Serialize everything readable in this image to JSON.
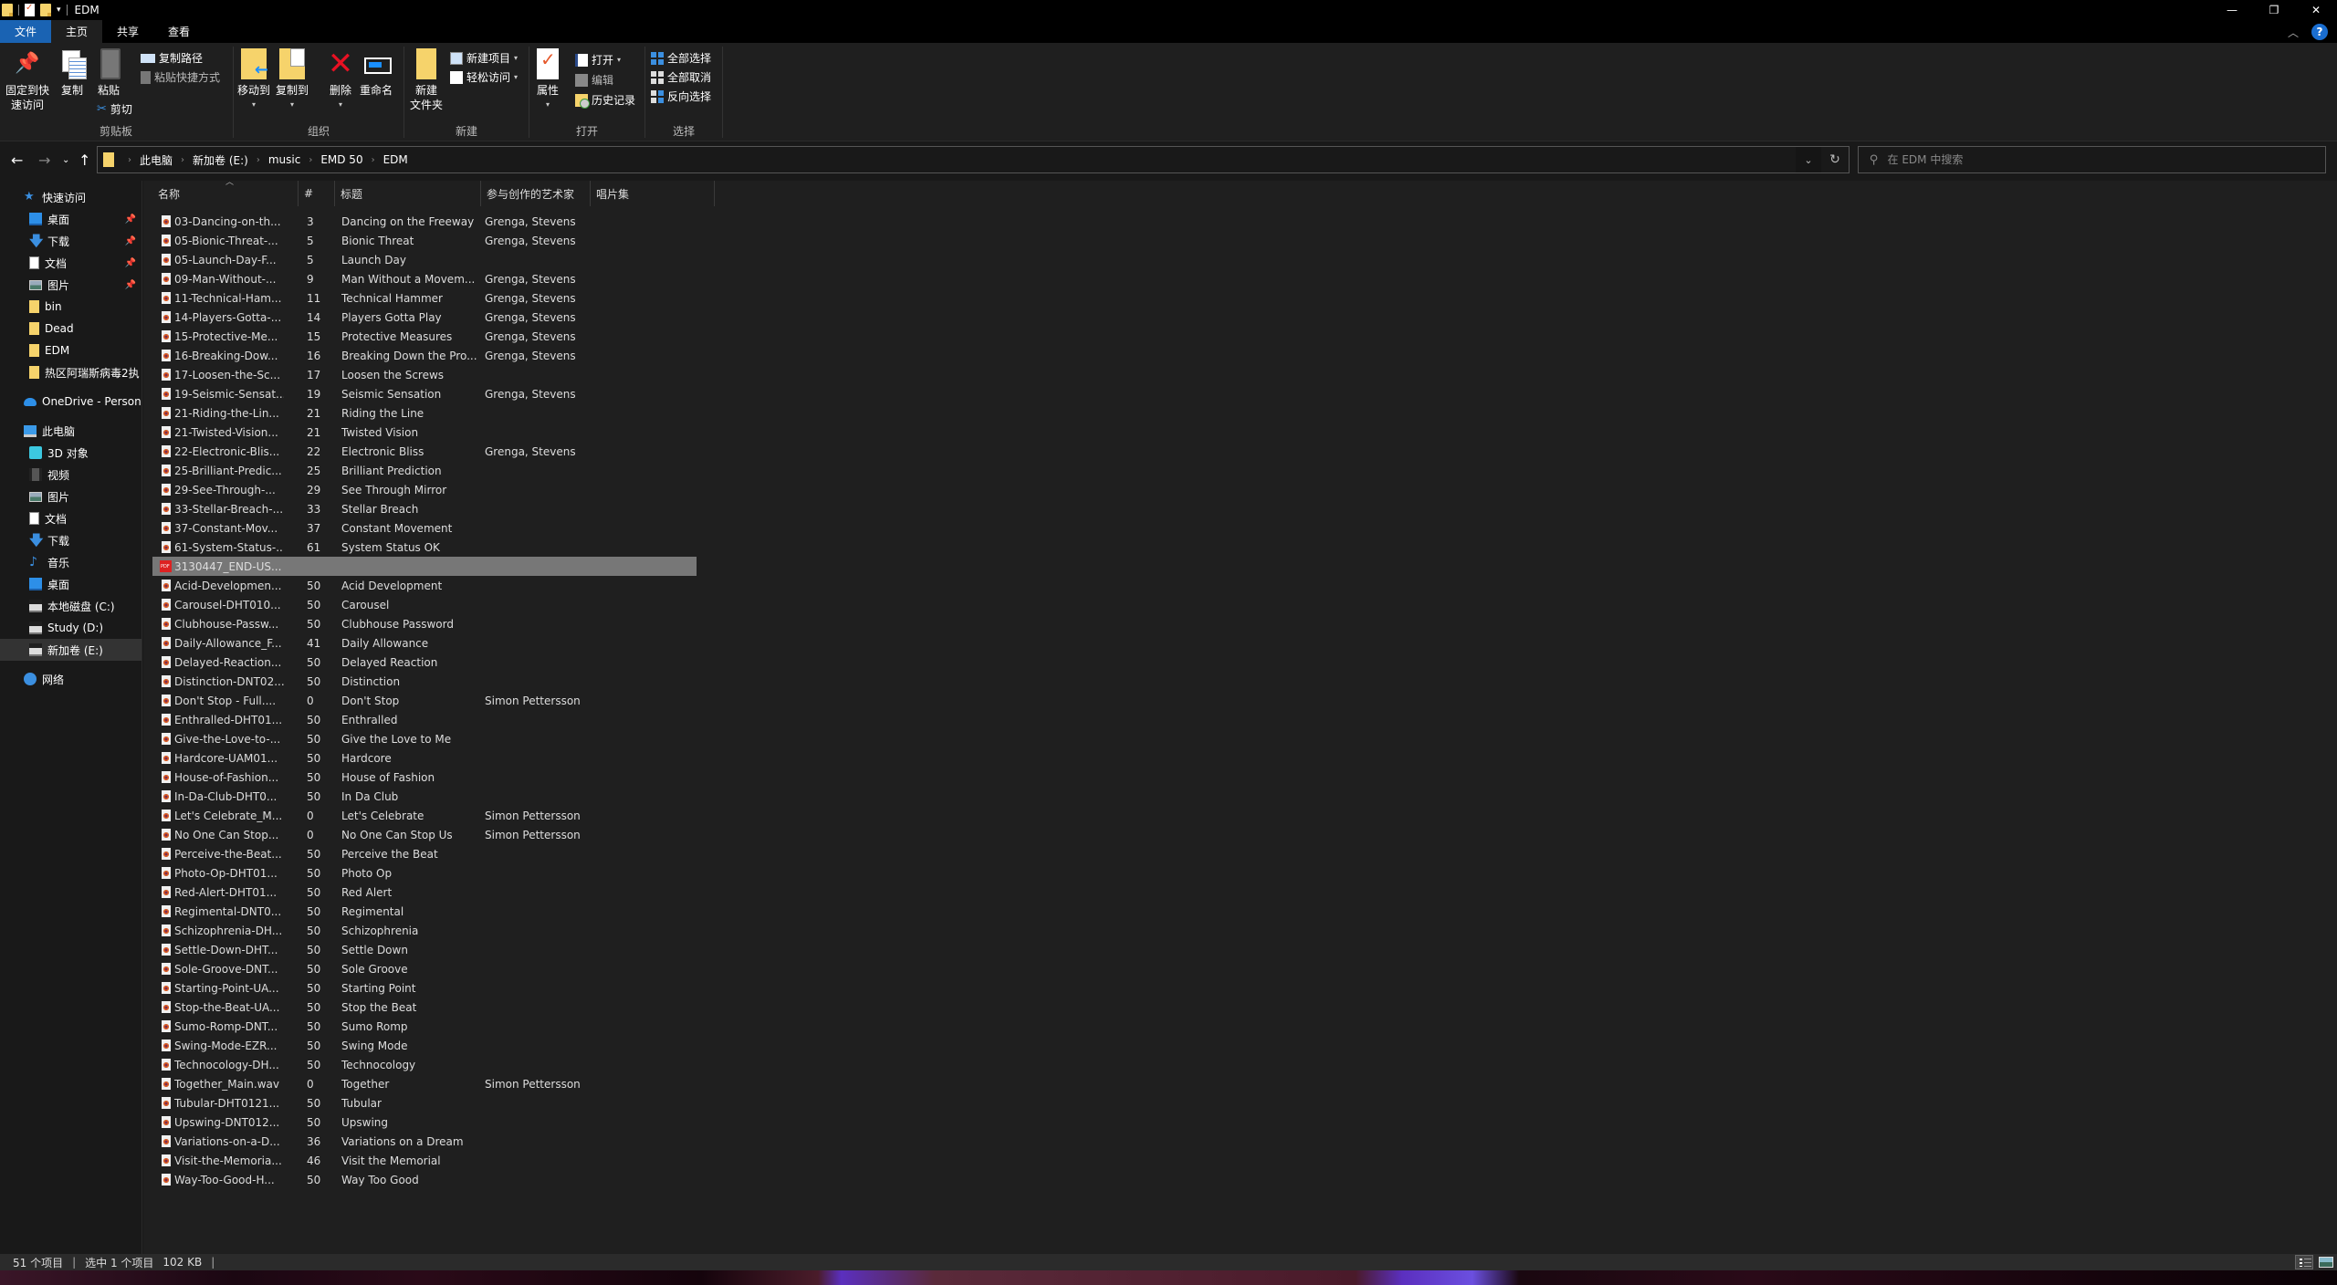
{
  "window": {
    "title": "EDM",
    "controls": {
      "minimize": "—",
      "maximize": "❐",
      "close": "✕"
    }
  },
  "ribbon": {
    "tabs": [
      {
        "label": "文件"
      },
      {
        "label": "主页"
      },
      {
        "label": "共享"
      },
      {
        "label": "查看"
      }
    ],
    "groups": {
      "clipboard": {
        "label": "剪贴板",
        "pin": "固定到快\n速访问",
        "pin_line1": "固定到快",
        "pin_line2": "速访问",
        "copy": "复制",
        "paste": "粘贴",
        "copy_path": "复制路径",
        "paste_shortcut": "粘贴快捷方式",
        "cut": "剪切"
      },
      "organize": {
        "label": "组织",
        "move_to": "移动到",
        "copy_to": "复制到",
        "delete": "删除",
        "rename": "重命名"
      },
      "new": {
        "label": "新建",
        "new_folder_line1": "新建",
        "new_folder_line2": "文件夹",
        "new_item": "新建项目",
        "easy_access": "轻松访问"
      },
      "open": {
        "label": "打开",
        "properties": "属性",
        "open": "打开",
        "edit": "编辑",
        "history": "历史记录"
      },
      "select": {
        "label": "选择",
        "select_all": "全部选择",
        "select_none": "全部取消",
        "invert_selection": "反向选择"
      }
    }
  },
  "address": {
    "breadcrumb": [
      "此电脑",
      "新加卷 (E:)",
      "music",
      "EMD 50",
      "EDM"
    ],
    "search_placeholder": "在 EDM 中搜索"
  },
  "sidebar": {
    "quick_access": {
      "label": "快速访问",
      "items": [
        {
          "label": "桌面",
          "icon": "desktop-icon",
          "pinned": true
        },
        {
          "label": "下载",
          "icon": "download-icon",
          "pinned": true
        },
        {
          "label": "文档",
          "icon": "document-icon",
          "pinned": true
        },
        {
          "label": "图片",
          "icon": "pictures-icon",
          "pinned": true
        },
        {
          "label": "bin",
          "icon": "folder-icon",
          "pinned": false
        },
        {
          "label": "Dead",
          "icon": "folder-icon",
          "pinned": false
        },
        {
          "label": "EDM",
          "icon": "folder-icon",
          "pinned": false
        },
        {
          "label": "热区阿瑞斯病毒2执",
          "icon": "folder-icon",
          "pinned": false
        }
      ]
    },
    "onedrive": {
      "label": "OneDrive - Persona"
    },
    "this_pc": {
      "label": "此电脑",
      "items": [
        {
          "label": "3D 对象",
          "icon": "3d-objects-icon"
        },
        {
          "label": "视频",
          "icon": "video-icon"
        },
        {
          "label": "图片",
          "icon": "pictures-icon"
        },
        {
          "label": "文档",
          "icon": "document-icon"
        },
        {
          "label": "下载",
          "icon": "download-icon"
        },
        {
          "label": "音乐",
          "icon": "music-icon"
        },
        {
          "label": "桌面",
          "icon": "desktop-icon"
        },
        {
          "label": "本地磁盘 (C:)",
          "icon": "drive-icon"
        },
        {
          "label": "Study (D:)",
          "icon": "drive-icon"
        },
        {
          "label": "新加卷 (E:)",
          "icon": "drive-icon",
          "selected": true
        }
      ]
    },
    "network": {
      "label": "网络"
    }
  },
  "filelist": {
    "columns": [
      "名称",
      "#",
      "标题",
      "参与创作的艺术家",
      "唱片集"
    ],
    "rows": [
      {
        "name": "03-Dancing-on-th...",
        "num": "3",
        "title": "Dancing on the Freeway",
        "artist": "Grenga, Stevens"
      },
      {
        "name": "05-Bionic-Threat-...",
        "num": "5",
        "title": "Bionic Threat",
        "artist": "Grenga, Stevens"
      },
      {
        "name": "05-Launch-Day-F...",
        "num": "5",
        "title": "Launch Day",
        "artist": ""
      },
      {
        "name": "09-Man-Without-...",
        "num": "9",
        "title": "Man Without a Movem...",
        "artist": "Grenga, Stevens"
      },
      {
        "name": "11-Technical-Ham...",
        "num": "11",
        "title": "Technical Hammer",
        "artist": "Grenga, Stevens"
      },
      {
        "name": "14-Players-Gotta-...",
        "num": "14",
        "title": "Players Gotta Play",
        "artist": "Grenga, Stevens"
      },
      {
        "name": "15-Protective-Me...",
        "num": "15",
        "title": "Protective Measures",
        "artist": "Grenga, Stevens"
      },
      {
        "name": "16-Breaking-Dow...",
        "num": "16",
        "title": "Breaking Down the Pro...",
        "artist": "Grenga, Stevens"
      },
      {
        "name": "17-Loosen-the-Sc...",
        "num": "17",
        "title": "Loosen the Screws",
        "artist": ""
      },
      {
        "name": "19-Seismic-Sensat...",
        "num": "19",
        "title": "Seismic Sensation",
        "artist": "Grenga, Stevens"
      },
      {
        "name": "21-Riding-the-Lin...",
        "num": "21",
        "title": "Riding the Line",
        "artist": ""
      },
      {
        "name": "21-Twisted-Vision...",
        "num": "21",
        "title": "Twisted Vision",
        "artist": ""
      },
      {
        "name": "22-Electronic-Blis...",
        "num": "22",
        "title": "Electronic Bliss",
        "artist": "Grenga, Stevens"
      },
      {
        "name": "25-Brilliant-Predic...",
        "num": "25",
        "title": "Brilliant Prediction",
        "artist": ""
      },
      {
        "name": "29-See-Through-...",
        "num": "29",
        "title": "See Through Mirror",
        "artist": ""
      },
      {
        "name": "33-Stellar-Breach-...",
        "num": "33",
        "title": "Stellar Breach",
        "artist": ""
      },
      {
        "name": "37-Constant-Mov...",
        "num": "37",
        "title": "Constant Movement",
        "artist": ""
      },
      {
        "name": "61-System-Status-...",
        "num": "61",
        "title": "System Status OK",
        "artist": ""
      },
      {
        "name": "3130447_END-US...",
        "num": "",
        "title": "",
        "artist": "",
        "type": "pdf",
        "selected": true
      },
      {
        "name": "Acid-Developmen...",
        "num": "50",
        "title": "Acid Development",
        "artist": ""
      },
      {
        "name": "Carousel-DHT010...",
        "num": "50",
        "title": "Carousel",
        "artist": ""
      },
      {
        "name": "Clubhouse-Passw...",
        "num": "50",
        "title": "Clubhouse Password",
        "artist": ""
      },
      {
        "name": "Daily-Allowance_F...",
        "num": "41",
        "title": "Daily Allowance",
        "artist": ""
      },
      {
        "name": "Delayed-Reaction...",
        "num": "50",
        "title": "Delayed Reaction",
        "artist": ""
      },
      {
        "name": "Distinction-DNT02...",
        "num": "50",
        "title": "Distinction",
        "artist": ""
      },
      {
        "name": "Don't Stop - Full....",
        "num": "0",
        "title": "Don't Stop",
        "artist": "Simon Pettersson"
      },
      {
        "name": "Enthralled-DHT01...",
        "num": "50",
        "title": "Enthralled",
        "artist": ""
      },
      {
        "name": "Give-the-Love-to-...",
        "num": "50",
        "title": "Give the Love to Me",
        "artist": ""
      },
      {
        "name": "Hardcore-UAM01...",
        "num": "50",
        "title": "Hardcore",
        "artist": ""
      },
      {
        "name": "House-of-Fashion...",
        "num": "50",
        "title": "House of Fashion",
        "artist": ""
      },
      {
        "name": "In-Da-Club-DHT0...",
        "num": "50",
        "title": "In Da Club",
        "artist": ""
      },
      {
        "name": "Let's Celebrate_M...",
        "num": "0",
        "title": "Let's Celebrate",
        "artist": "Simon Pettersson"
      },
      {
        "name": "No One Can Stop...",
        "num": "0",
        "title": "No One Can Stop Us",
        "artist": "Simon Pettersson"
      },
      {
        "name": "Perceive-the-Beat...",
        "num": "50",
        "title": "Perceive the Beat",
        "artist": ""
      },
      {
        "name": "Photo-Op-DHT01...",
        "num": "50",
        "title": "Photo Op",
        "artist": ""
      },
      {
        "name": "Red-Alert-DHT01...",
        "num": "50",
        "title": "Red Alert",
        "artist": ""
      },
      {
        "name": "Regimental-DNT0...",
        "num": "50",
        "title": "Regimental",
        "artist": ""
      },
      {
        "name": "Schizophrenia-DH...",
        "num": "50",
        "title": "Schizophrenia",
        "artist": ""
      },
      {
        "name": "Settle-Down-DHT...",
        "num": "50",
        "title": "Settle Down",
        "artist": ""
      },
      {
        "name": "Sole-Groove-DNT...",
        "num": "50",
        "title": "Sole Groove",
        "artist": ""
      },
      {
        "name": "Starting-Point-UA...",
        "num": "50",
        "title": "Starting Point",
        "artist": ""
      },
      {
        "name": "Stop-the-Beat-UA...",
        "num": "50",
        "title": "Stop the Beat",
        "artist": ""
      },
      {
        "name": "Sumo-Romp-DNT...",
        "num": "50",
        "title": "Sumo Romp",
        "artist": ""
      },
      {
        "name": "Swing-Mode-EZR...",
        "num": "50",
        "title": "Swing Mode",
        "artist": ""
      },
      {
        "name": "Technocology-DH...",
        "num": "50",
        "title": "Technocology",
        "artist": ""
      },
      {
        "name": "Together_Main.wav",
        "num": "0",
        "title": "Together",
        "artist": "Simon Pettersson"
      },
      {
        "name": "Tubular-DHT0121...",
        "num": "50",
        "title": "Tubular",
        "artist": ""
      },
      {
        "name": "Upswing-DNT012...",
        "num": "50",
        "title": "Upswing",
        "artist": ""
      },
      {
        "name": "Variations-on-a-D...",
        "num": "36",
        "title": "Variations on a Dream",
        "artist": ""
      },
      {
        "name": "Visit-the-Memoria...",
        "num": "46",
        "title": "Visit the Memorial",
        "artist": ""
      },
      {
        "name": "Way-Too-Good-H...",
        "num": "50",
        "title": "Way Too Good",
        "artist": ""
      }
    ]
  },
  "statusbar": {
    "item_count": "51 个项目",
    "selection": "选中 1 个项目",
    "size": "102 KB"
  },
  "colors": {
    "accent": "#1a63b3",
    "selection": "#777777",
    "background": "#1f1f1f"
  }
}
